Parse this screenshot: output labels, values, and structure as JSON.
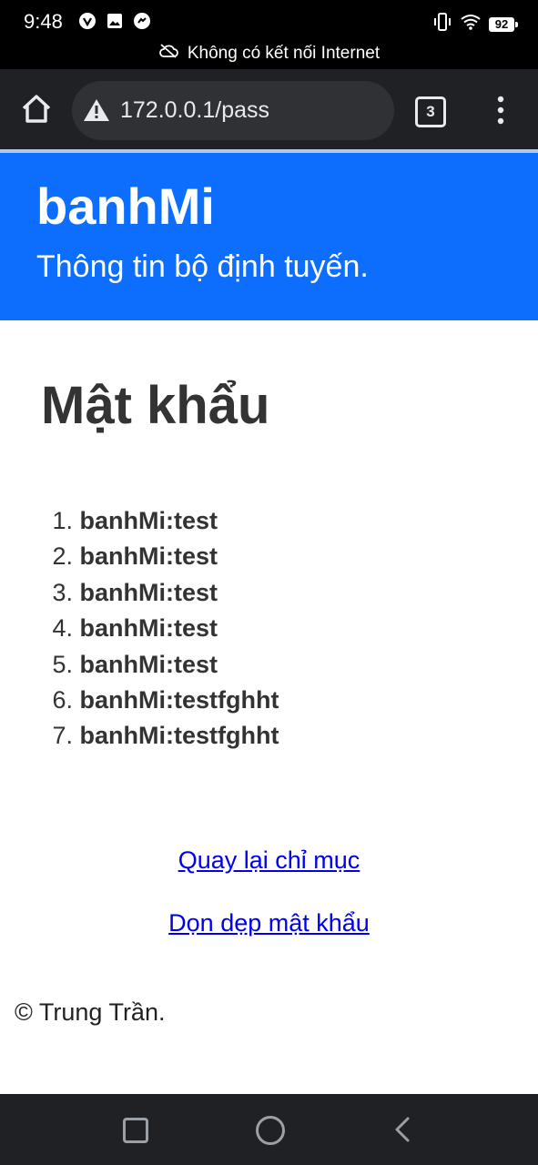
{
  "status_bar": {
    "time": "9:48",
    "battery": "92",
    "offline_message": "Không có kết nối Internet"
  },
  "browser": {
    "url": "172.0.0.1/pass",
    "tab_count": "3"
  },
  "header": {
    "brand": "banhMi",
    "subtitle": "Thông tin bộ định tuyến."
  },
  "main": {
    "heading": "Mật khẩu",
    "passwords": [
      {
        "num": "1.",
        "value": "banhMi:test"
      },
      {
        "num": "2.",
        "value": "banhMi:test"
      },
      {
        "num": "3.",
        "value": "banhMi:test"
      },
      {
        "num": "4.",
        "value": "banhMi:test"
      },
      {
        "num": "5.",
        "value": "banhMi:test"
      },
      {
        "num": "6.",
        "value": "banhMi:testfghht"
      },
      {
        "num": "7.",
        "value": "banhMi:testfghht"
      }
    ],
    "back_link": "Quay lại chỉ mục",
    "clear_link": "Dọn dẹp mật khẩu"
  },
  "footer": {
    "copyright": "© Trung Trần."
  }
}
